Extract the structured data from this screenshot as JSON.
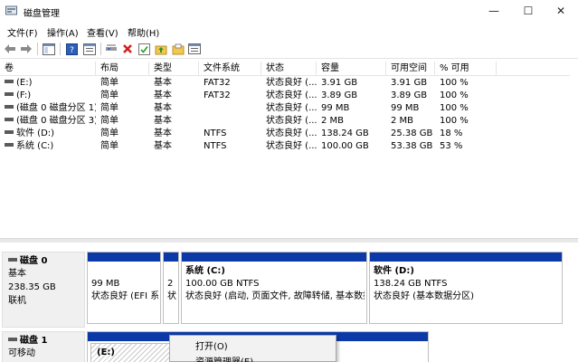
{
  "window": {
    "title": "磁盘管理",
    "minimize_glyph": "—",
    "maximize_glyph": "☐",
    "close_glyph": "✕"
  },
  "menu": [
    "文件(F)",
    "操作(A)",
    "查看(V)",
    "帮助(H)"
  ],
  "toolbar_icons": [
    "back-arrow-icon",
    "forward-arrow-icon",
    "console-tree-icon",
    "help-icon",
    "properties-icon",
    "connect-disk-icon",
    "delete-icon",
    "check-icon",
    "up-folder-icon",
    "open-folder-icon",
    "window-list-icon"
  ],
  "columns": [
    "卷",
    "布局",
    "类型",
    "文件系统",
    "状态",
    "容量",
    "可用空间",
    "% 可用"
  ],
  "volumes": [
    {
      "name": "(E:)",
      "layout": "简单",
      "type": "基本",
      "fs": "FAT32",
      "status": "状态良好 (...",
      "capacity": "3.91 GB",
      "free": "3.91 GB",
      "pct": "100 %"
    },
    {
      "name": "(F:)",
      "layout": "简单",
      "type": "基本",
      "fs": "FAT32",
      "status": "状态良好 (...",
      "capacity": "3.89 GB",
      "free": "3.89 GB",
      "pct": "100 %"
    },
    {
      "name": "(磁盘 0 磁盘分区 1)",
      "layout": "简单",
      "type": "基本",
      "fs": "",
      "status": "状态良好 (...",
      "capacity": "99 MB",
      "free": "99 MB",
      "pct": "100 %"
    },
    {
      "name": "(磁盘 0 磁盘分区 3)",
      "layout": "简单",
      "type": "基本",
      "fs": "",
      "status": "状态良好 (...",
      "capacity": "2 MB",
      "free": "2 MB",
      "pct": "100 %"
    },
    {
      "name": "软件 (D:)",
      "layout": "简单",
      "type": "基本",
      "fs": "NTFS",
      "status": "状态良好 (...",
      "capacity": "138.24 GB",
      "free": "25.38 GB",
      "pct": "18 %"
    },
    {
      "name": "系统 (C:)",
      "layout": "简单",
      "type": "基本",
      "fs": "NTFS",
      "status": "状态良好 (...",
      "capacity": "100.00 GB",
      "free": "53.38 GB",
      "pct": "53 %"
    }
  ],
  "disk0": {
    "name": "磁盘 0",
    "type": "基本",
    "size": "238.35 GB",
    "state": "联机",
    "partitions": [
      {
        "name": "",
        "size": "99 MB",
        "status": "状态良好 (EFI 系"
      },
      {
        "name": "",
        "size": "2",
        "status": "状"
      },
      {
        "name": "系统 (C:)",
        "size": "100.00 GB NTFS",
        "status": "状态良好 (启动, 页面文件, 故障转储, 基本数据"
      },
      {
        "name": "软件 (D:)",
        "size": "138.24 GB NTFS",
        "status": "状态良好 (基本数据分区)"
      }
    ]
  },
  "disk1": {
    "name": "磁盘 1",
    "type": "可移动",
    "partition_label": "(E:)"
  },
  "context_menu": [
    "打开(O)",
    "资源管理器(E)"
  ]
}
